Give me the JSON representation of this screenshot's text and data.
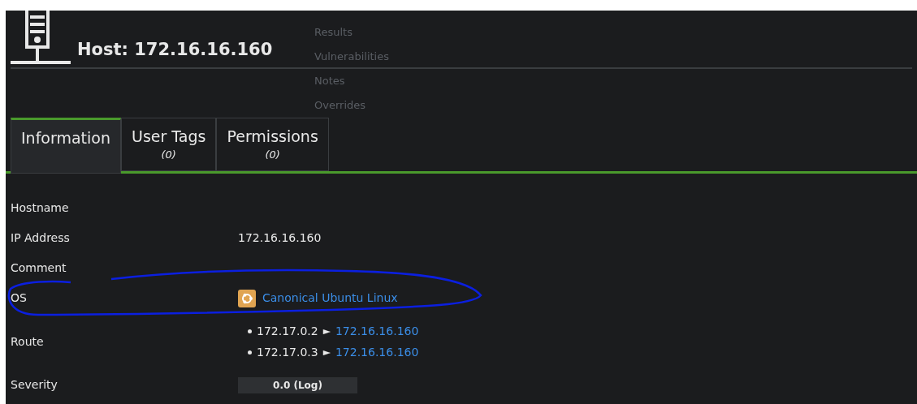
{
  "header": {
    "title": "Host: 172.16.16.160"
  },
  "menu": [
    "Results",
    "Vulnerabilities",
    "Notes",
    "Overrides"
  ],
  "tabs": [
    {
      "label": "Information",
      "selected": true
    },
    {
      "label": "User Tags",
      "count": "(0)",
      "selected": false
    },
    {
      "label": "Permissions",
      "count": "(0)",
      "selected": false
    }
  ],
  "details": [
    {
      "label": "Hostname",
      "kind": "text"
    },
    {
      "label": "IP Address",
      "kind": "text",
      "value": "172.16.16.160"
    },
    {
      "label": "Comment",
      "kind": "text"
    },
    {
      "label": "OS",
      "kind": "os",
      "value": "Canonical Ubuntu Linux"
    },
    {
      "label": "Route",
      "kind": "route",
      "hops": [
        {
          "from": "172.17.0.2",
          "arrow": "►",
          "to": "172.16.16.160"
        },
        {
          "from": "172.17.0.3",
          "arrow": "►",
          "to": "172.16.16.160"
        }
      ]
    },
    {
      "label": "Severity",
      "kind": "severity",
      "value": "0.0 (Log)"
    }
  ]
}
